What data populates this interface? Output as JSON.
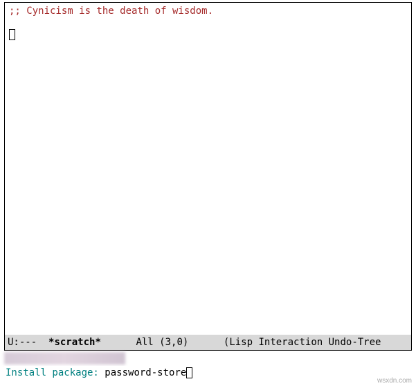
{
  "buffer": {
    "comment": ";; Cynicism is the death of wisdom."
  },
  "modeline": {
    "status": "U:---  ",
    "buffer_name": "*scratch*",
    "gap1": "      ",
    "position": "All (3,0)",
    "gap2": "      ",
    "mode": "(Lisp Interaction Undo-Tree"
  },
  "minibuffer": {
    "prompt": "Install package: ",
    "input": "password-store"
  },
  "watermark": "wsxdn.com"
}
